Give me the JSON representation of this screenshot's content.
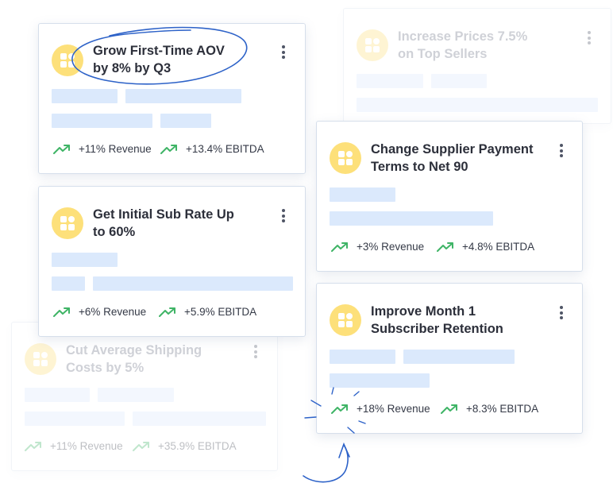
{
  "colors": {
    "icon_bg": "#fde07a",
    "icon_fg": "#ffffff",
    "skeleton": "#dbe9fc",
    "trend_green": "#3fb466",
    "annotation_blue": "#2d62c8"
  },
  "icons": {
    "card": "grid-widget-icon",
    "trend": "trending-up-icon",
    "menu": "more-vertical-icon"
  },
  "cards": [
    {
      "title_1": "Grow First-Time AOV",
      "title_2": "by 8% by Q3",
      "revenue": "+11% Revenue",
      "ebitda": "+13.4% EBITDA",
      "faded": false
    },
    {
      "title_1": "Increase Prices 7.5%",
      "title_2": "on Top Sellers",
      "faded": true
    },
    {
      "title_1": "Change Supplier Payment",
      "title_2": "Terms to Net 90",
      "revenue": "+3% Revenue",
      "ebitda": "+4.8% EBITDA",
      "faded": false
    },
    {
      "title_1": "Get Initial Sub Rate Up",
      "title_2": "to 60%",
      "revenue": "+6% Revenue",
      "ebitda": "+5.9% EBITDA",
      "faded": false
    },
    {
      "title_1": "Improve Month 1",
      "title_2": "Subscriber Retention",
      "revenue": "+18% Revenue",
      "ebitda": "+8.3% EBITDA",
      "faded": false
    },
    {
      "title_1": "Cut Average Shipping",
      "title_2": "Costs by 5%",
      "revenue": "+11% Revenue",
      "ebitda": "+35.9% EBITDA",
      "faded": true
    }
  ]
}
